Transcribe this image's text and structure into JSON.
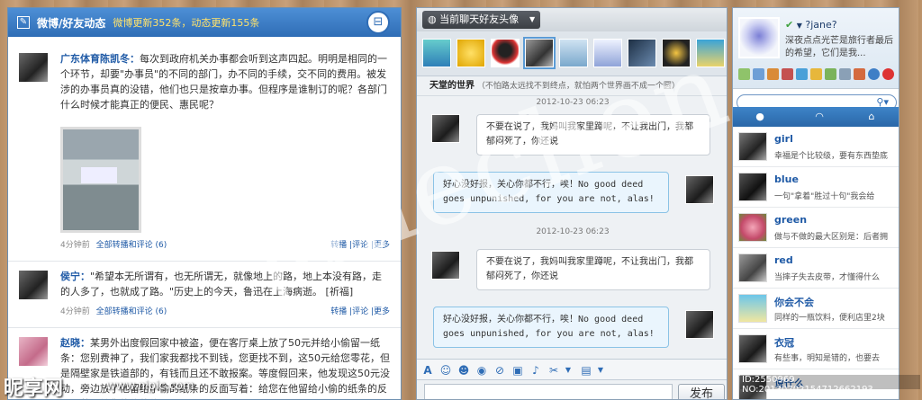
{
  "left": {
    "title": "微博/好友动态",
    "stats": "微博更新352条，动态更新155条",
    "posts": [
      {
        "author": "广东体育陈凯冬：",
        "text": "每次到政府机关办事都会听到这声四起。明明是相同的一个环节，却要\"办事员\"的不同的部门，办不同的手续，交不同的费用。被发涉的办事员真的没错，他们也只是按章办事。但程序是谁制订的呢？各部门什么时候才能真正的便民、惠民呢？",
        "time": "4分钟前",
        "all": "全部转播和评论 (6)",
        "actions": "转播 |评论 |更多"
      },
      {
        "author": "侯宁：",
        "text": "\"希望本无所谓有，也无所谓无，就像地上的路，地上本没有路，走的人多了，也就成了路。\"历史上的今天，鲁迅在上海病逝。 [祈福]",
        "time": "4分钟前",
        "all": "全部转播和评论 (6)",
        "actions": "转播 |评论 |更多"
      },
      {
        "author": "赵晓：",
        "text": "某男外出度假回家中被盗，便在客厅桌上放了50元并给小偷留一纸条：您别费神了，我们家我都找不到钱，您更找不到，这50元给您零花，但是隔壁家是铁道部的，有钱而且还不敢报案。等度假回来，他发现这50元没动，旁边放了他留给小偷的纸条的反面写着：给您在他留给小偷的纸条的反面写着，给您的信的信"
      }
    ]
  },
  "center": {
    "tab_label": "当前聊天好友头像",
    "tip_title": "天堂的世界",
    "tip_text": "（不怕路太远找不到终点，就怕两个世界画不成一个圆）",
    "messages": [
      {
        "time": "2012-10-23 06:23",
        "in": "不要在说了，我妈叫我家里蹲呢，不让我出门，我都郁闷死了，你还说",
        "out": "好心没好报，关心你都不行，唉！No good deed goes unpunished, for you are not, alas!"
      },
      {
        "time": "2012-10-23 06:23",
        "in": "不要在说了，我妈叫我家里蹲呢，不让我出门，我都郁闷死了，你还说",
        "out": "好心没好报，关心你都不行，唉！No good deed goes unpunished, for you are not, alas!"
      }
    ],
    "send_label": "发布"
  },
  "right": {
    "name": "?jane?",
    "signature": "深夜点点光芒是旅行者最后的希望，它们是我...",
    "friends": [
      {
        "name": "girl",
        "status": "幸福是个比较级，要有东西垫底"
      },
      {
        "name": "blue",
        "status": "一句\"拿着\"胜过十句\"我会给"
      },
      {
        "name": "green",
        "status": "做与不做的最大区别是：后者拥"
      },
      {
        "name": "red",
        "status": "当摔子失去皮带，才懂得什么"
      },
      {
        "name": "你会不会",
        "status": "同样的一瓶饮料，便利店里2块"
      },
      {
        "name": "衣冠",
        "status": "有些事，明知是错的，也要去"
      },
      {
        "name": "说什么",
        "status": ""
      }
    ]
  },
  "watermark": "janechen",
  "brand": "昵享网",
  "brand_url": "www.nipic.com",
  "serial": "ID:2550969 NO:20130702154712662193",
  "colors": {
    "accent": "#2f6db6",
    "header_blue": "#4d8fd6",
    "stat_yellow": "#ffe26b"
  }
}
